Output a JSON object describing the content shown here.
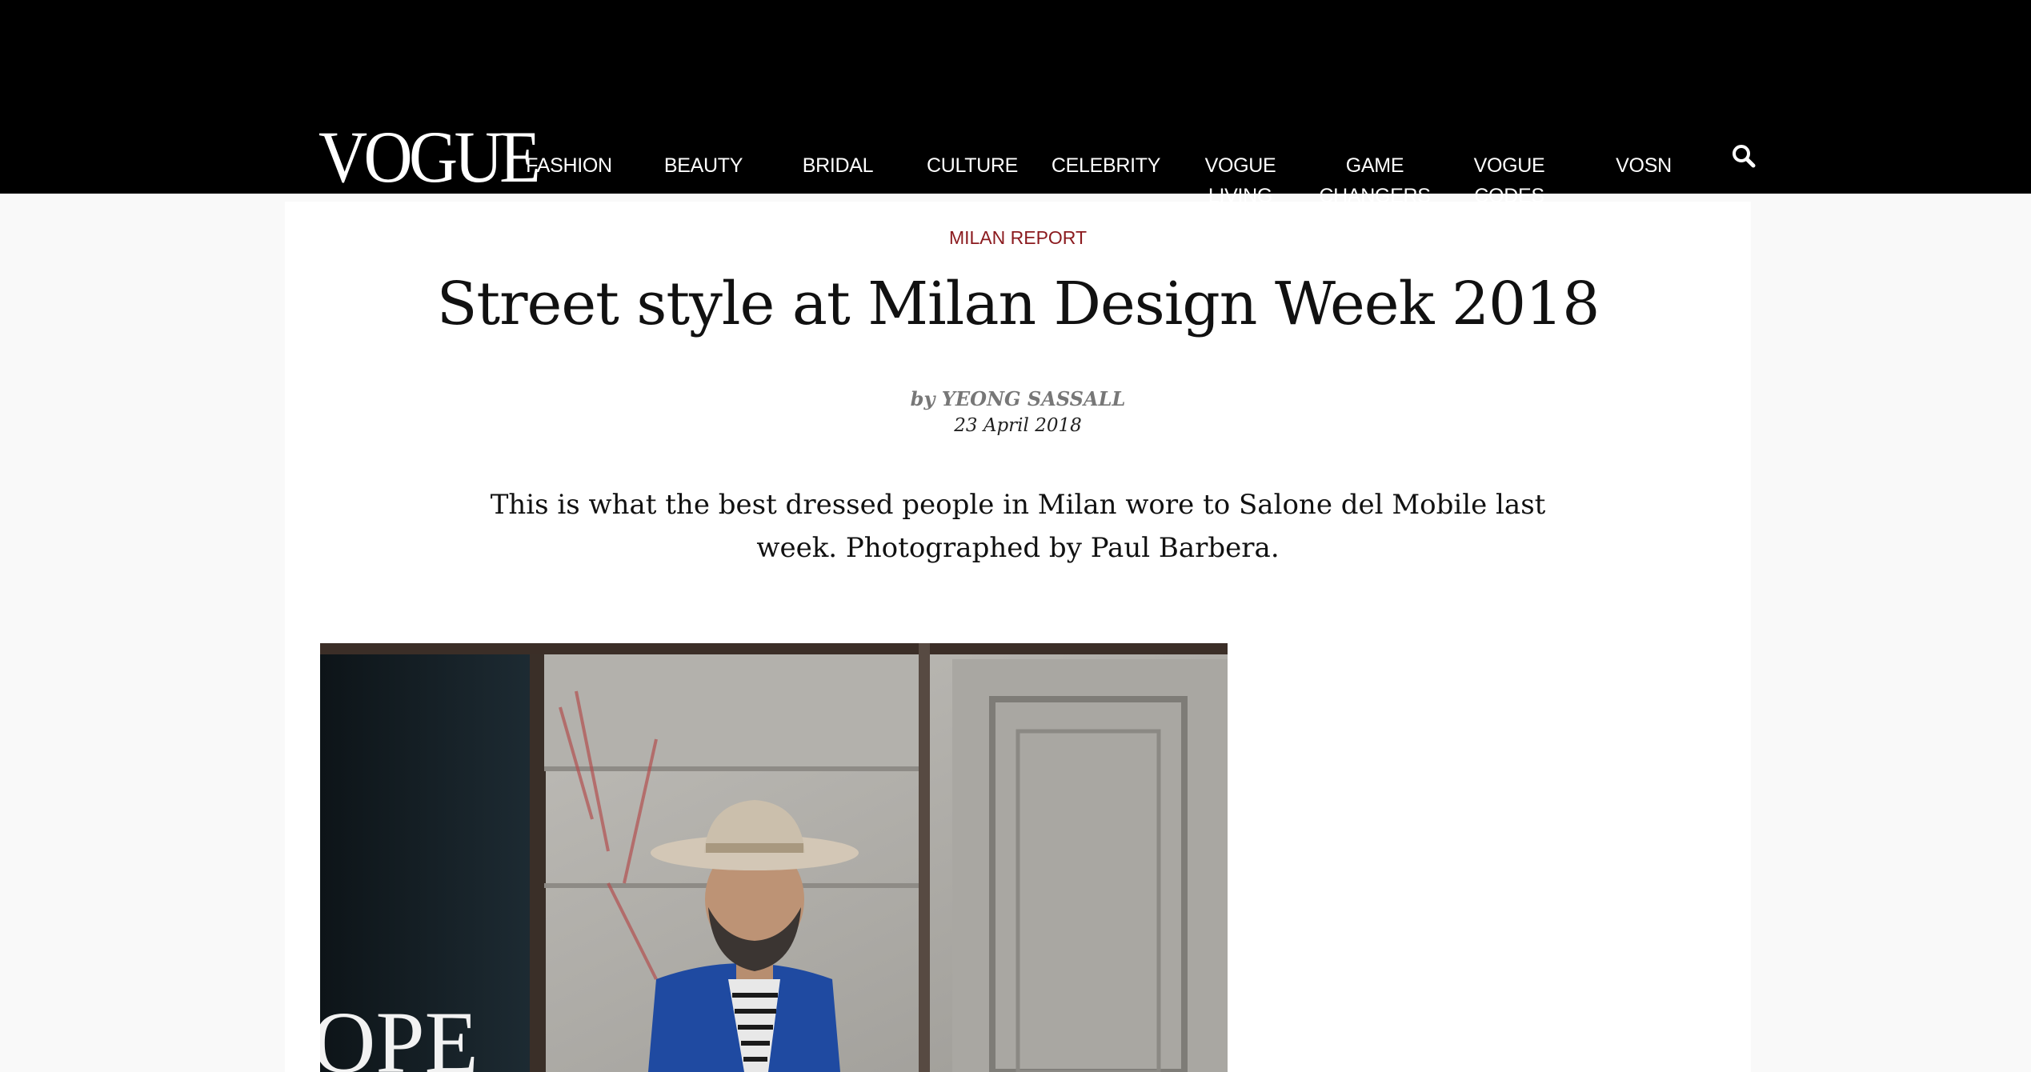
{
  "header": {
    "logo_text": "VOGUE",
    "nav": [
      {
        "label": "FASHION"
      },
      {
        "label": "BEAUTY"
      },
      {
        "label": "BRIDAL"
      },
      {
        "label": "CULTURE"
      },
      {
        "label": "CELEBRITY"
      },
      {
        "label": "VOGUE LIVING"
      },
      {
        "label": "GAME CHANGERS"
      },
      {
        "label": "VOGUE CODES"
      },
      {
        "label": "VOSN"
      }
    ],
    "search_icon": "search-icon"
  },
  "article": {
    "kicker": "MILAN REPORT",
    "title": "Street style at Milan Design Week 2018",
    "byline_prefix": "by",
    "author": "YEONG SASSALL",
    "date": "23 April 2018",
    "standfirst": "This is what the best dressed people in Milan wore to Salone del Mobile last week. Photographed by Paul Barbera.",
    "hero_image_text": "OPE"
  },
  "colors": {
    "topbar": "#000000",
    "kicker": "#8b1a1e",
    "background": "#f9f9f9"
  }
}
